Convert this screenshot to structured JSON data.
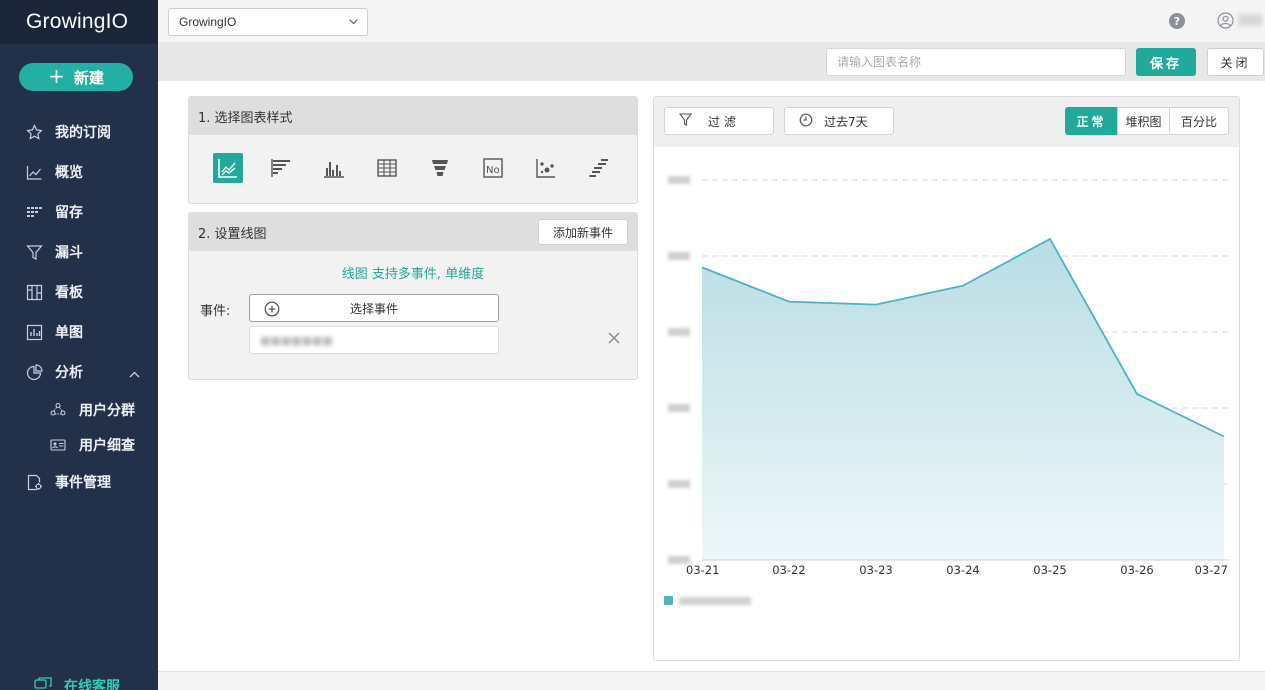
{
  "app": {
    "logo": "GrowingIO"
  },
  "sidebar": {
    "new_label": "新建",
    "items": [
      {
        "label": "我的订阅",
        "icon": "star-icon"
      },
      {
        "label": "概览",
        "icon": "line-chart-icon"
      },
      {
        "label": "留存",
        "icon": "retention-icon"
      },
      {
        "label": "漏斗",
        "icon": "funnel-icon"
      },
      {
        "label": "看板",
        "icon": "dashboard-icon"
      },
      {
        "label": "单图",
        "icon": "bar-chart-icon"
      },
      {
        "label": "分析",
        "icon": "pie-icon",
        "expanded": true
      }
    ],
    "sub_items": [
      {
        "label": "用户分群",
        "icon": "user-group-icon"
      },
      {
        "label": "用户细查",
        "icon": "id-card-icon"
      }
    ],
    "event_mgmt_label": "事件管理",
    "support_label": "在线客服"
  },
  "topbar": {
    "project": "GrowingIO",
    "help": "?"
  },
  "actionbar": {
    "name_placeholder": "请输入图表名称",
    "save_label": "保存",
    "close_label": "关闭"
  },
  "step1": {
    "title": "1. 选择图表样式",
    "selected": "line"
  },
  "step2": {
    "title": "2. 设置线图",
    "add_event_label": "添加新事件",
    "hint": "线图 支持多事件, 单维度",
    "event_label": "事件:",
    "select_event_label": "选择事件"
  },
  "chart_toolbar": {
    "filter_label": "过 滤",
    "time_label": "过去7天",
    "modes": [
      "正常",
      "堆积图",
      "百分比"
    ],
    "active_mode": "正常"
  },
  "colors": {
    "accent": "#21a99b",
    "sidebar": "#22304a",
    "line": "#4fb3c0"
  },
  "chart_data": {
    "type": "area",
    "x": [
      "03-21",
      "03-22",
      "03-23",
      "03-24",
      "03-25",
      "03-26",
      "03-27"
    ],
    "series": [
      {
        "values": [
          770,
          680,
          672,
          722,
          845,
          437,
          325
        ]
      }
    ],
    "ylim": [
      0,
      1000
    ],
    "grid": true,
    "legend": "bottom-left"
  }
}
